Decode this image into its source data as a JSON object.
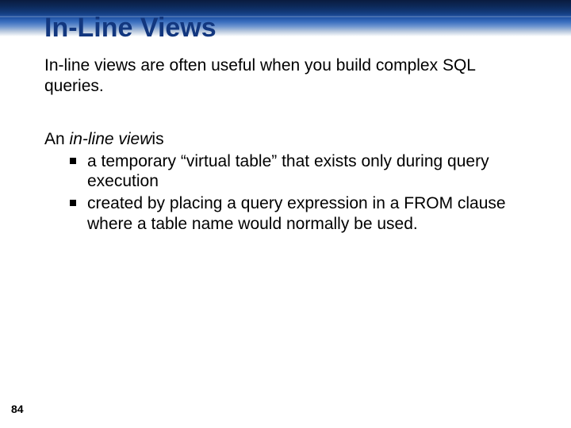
{
  "slide": {
    "title": "In-Line Views",
    "intro": "In-line views are often useful when you build complex SQL queries.",
    "definition_prefix": "An ",
    "definition_term": "in-line view",
    "definition_suffix": "is",
    "bullets": [
      "a temporary “virtual table” that exists only during query execution",
      "created by placing a query expression in a FROM clause where a table name would normally be used."
    ],
    "page_number": "84"
  }
}
